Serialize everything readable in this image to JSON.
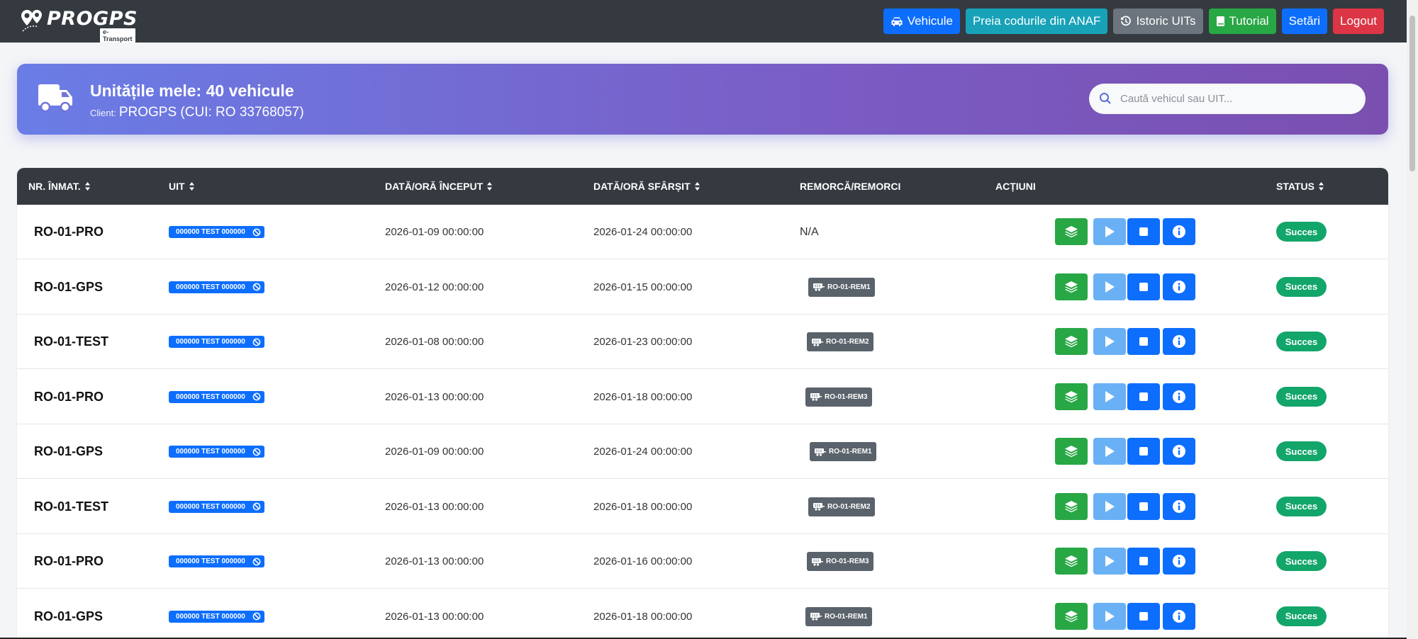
{
  "navbar": {
    "brand": "PROGPS",
    "brand_sub": "e-Transport",
    "buttons": [
      {
        "label": "Vehicule",
        "icon": "car-icon",
        "color": "#0d6efd"
      },
      {
        "label": "Preia codurile din ANAF",
        "icon": "",
        "color": "#17a2b8"
      },
      {
        "label": "Istoric UITs",
        "icon": "history-icon",
        "color": "#6c757d"
      },
      {
        "label": "Tutorial",
        "icon": "book-icon",
        "color": "#28a745"
      },
      {
        "label": "Setări",
        "icon": "",
        "color": "#0d6efd"
      },
      {
        "label": "Logout",
        "icon": "",
        "color": "#dc3545"
      }
    ]
  },
  "hero": {
    "title": "Unitățile mele: 40 vehicule",
    "client_label": "Client:",
    "client_value": "PROGPS (CUI: RO 33768057)",
    "icon": "truck-icon"
  },
  "search": {
    "placeholder": "Caută vehicul sau UIT...",
    "value": ""
  },
  "table": {
    "columns": [
      "NR. ÎNMAT.",
      "UIT",
      "DATĂ/ORĂ ÎNCEPUT",
      "DATĂ/ORĂ SFÂRȘIT",
      "REMORCĂ/REMORCI",
      "ACȚIUNI",
      "STATUS"
    ],
    "rows": [
      {
        "plate": "RO-01-PRO",
        "uit": "000000 TEST 000000",
        "start": "2026-01-09 00:00:00",
        "end": "2026-01-24 00:00:00",
        "trailer": "N/A",
        "status": "Succes"
      },
      {
        "plate": "RO-01-GPS",
        "uit": "000000 TEST 000000",
        "start": "2026-01-12 00:00:00",
        "end": "2026-01-15 00:00:00",
        "trailer": "RO-01-REM1",
        "status": "Succes"
      },
      {
        "plate": "RO-01-TEST",
        "uit": "000000 TEST 000000",
        "start": "2026-01-08 00:00:00",
        "end": "2026-01-23 00:00:00",
        "trailer": "RO-01-REM2",
        "status": "Succes"
      },
      {
        "plate": "RO-01-PRO",
        "uit": "000000 TEST 000000",
        "start": "2026-01-13 00:00:00",
        "end": "2026-01-18 00:00:00",
        "trailer": "RO-01-REM3",
        "status": "Succes"
      },
      {
        "plate": "RO-01-GPS",
        "uit": "000000 TEST 000000",
        "start": "2026-01-09 00:00:00",
        "end": "2026-01-24 00:00:00",
        "trailer": "RO-01-REM1",
        "status": "Succes"
      },
      {
        "plate": "RO-01-TEST",
        "uit": "000000 TEST 000000",
        "start": "2026-01-13 00:00:00",
        "end": "2026-01-18 00:00:00",
        "trailer": "RO-01-REM2",
        "status": "Succes"
      },
      {
        "plate": "RO-01-PRO",
        "uit": "000000 TEST 000000",
        "start": "2026-01-13 00:00:00",
        "end": "2026-01-16 00:00:00",
        "trailer": "RO-01-REM3",
        "status": "Succes"
      },
      {
        "plate": "RO-01-GPS",
        "uit": "000000 TEST 000000",
        "start": "2026-01-13 00:00:00",
        "end": "2026-01-18 00:00:00",
        "trailer": "RO-01-REM1",
        "status": "Succes"
      }
    ],
    "row_actions": [
      "layers-icon",
      "play-icon",
      "stop-icon",
      "info-icon"
    ]
  },
  "colors": {
    "navbar": "#343a40",
    "primary": "#0d6efd",
    "success": "#28a745",
    "status": "#12a66a",
    "danger": "#dc3545"
  }
}
